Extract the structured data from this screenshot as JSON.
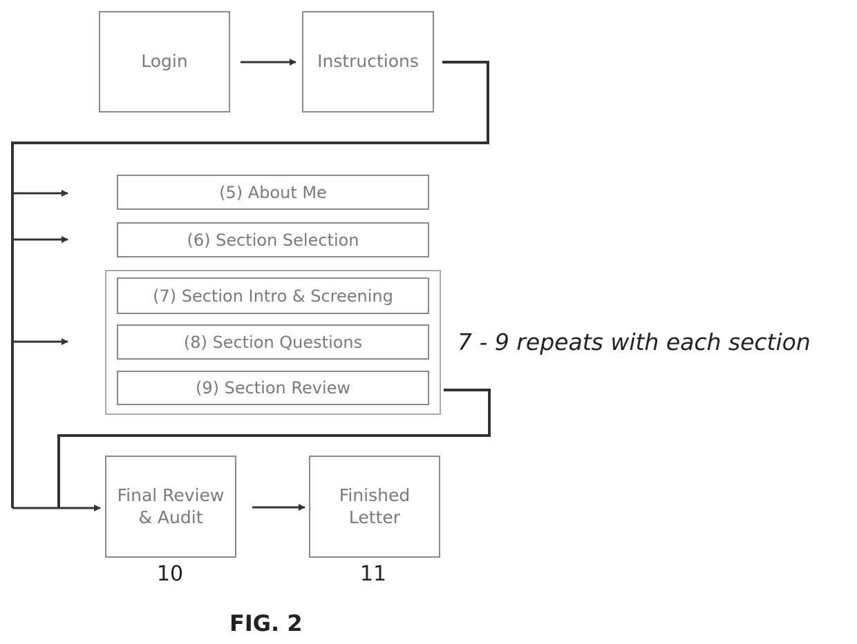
{
  "diagram": {
    "top_row": [
      {
        "id": "login",
        "label": "Login"
      },
      {
        "id": "instructions",
        "label": "Instructions"
      }
    ],
    "sections": [
      {
        "id": "about-me",
        "label": "(5) About Me"
      },
      {
        "id": "section-selection",
        "label": "(6) Section Selection"
      }
    ],
    "repeat_group": [
      {
        "id": "section-intro",
        "label": "(7) Section Intro & Screening"
      },
      {
        "id": "section-questions",
        "label": "(8) Section Questions"
      },
      {
        "id": "section-review",
        "label": "(9) Section Review"
      }
    ],
    "repeat_note": "7 - 9 repeats with each section",
    "bottom_row": [
      {
        "id": "final-review",
        "label_line1": "Final Review",
        "label_line2": "& Audit",
        "number": "10"
      },
      {
        "id": "finished-letter",
        "label_line1": "Finished",
        "label_line2": "Letter",
        "number": "11"
      }
    ],
    "figure_label": "FIG. 2"
  }
}
